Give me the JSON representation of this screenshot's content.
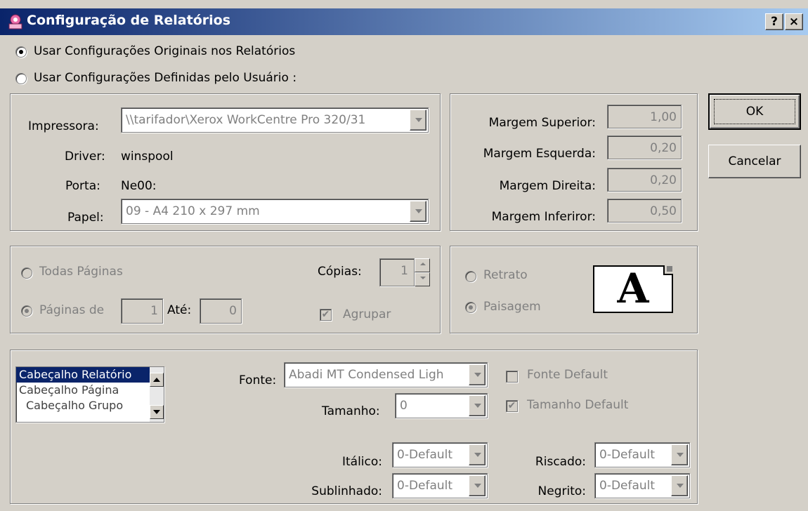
{
  "window": {
    "title": "Configuração de Relatórios",
    "help_button": "?",
    "close_button": "×"
  },
  "mode": {
    "original_label": "Usar Configurações Originais nos Relatórios",
    "user_label": "Usar Configurações Definidas pelo Usuário :",
    "selected": "original"
  },
  "printer": {
    "printer_label": "Impressora:",
    "printer_value": "\\\\tarifador\\Xerox WorkCentre Pro 320/31",
    "driver_label": "Driver:",
    "driver_value": "winspool",
    "port_label": "Porta:",
    "port_value": "Ne00:",
    "paper_label": "Papel:",
    "paper_value": "09  - A4 210 x 297 mm"
  },
  "margins": {
    "top_label": "Margem Superior:",
    "top_value": "1,00",
    "left_label": "Margem Esquerda:",
    "left_value": "0,20",
    "right_label": "Margem Direita:",
    "right_value": "0,20",
    "bottom_label": "Margem Inferiror:",
    "bottom_value": "0,50"
  },
  "buttons": {
    "ok": "OK",
    "cancel": "Cancelar"
  },
  "pages": {
    "all_label": "Todas Páginas",
    "range_label": "Páginas de",
    "from_value": "1",
    "to_label": "Até:",
    "to_value": "0",
    "copies_label": "Cópias:",
    "copies_value": "1",
    "collate_label": "Agrupar",
    "collate_checked": true,
    "selected": "range"
  },
  "orientation": {
    "portrait_label": "Retrato",
    "landscape_label": "Paisagem",
    "selected": "landscape",
    "preview_glyph": "A"
  },
  "sections": {
    "items": [
      "Cabeçalho Relatório",
      "Cabeçalho Página",
      "Cabeçalho Grupo"
    ],
    "selected_index": 0
  },
  "font": {
    "font_label": "Fonte:",
    "font_value": "Abadi MT Condensed Ligh",
    "font_default_label": "Fonte Default",
    "font_default_checked": false,
    "size_label": "Tamanho:",
    "size_value": "0",
    "size_default_label": "Tamanho Default",
    "size_default_checked": true,
    "italic_label": "Itálico:",
    "italic_value": "0-Default",
    "strike_label": "Riscado:",
    "strike_value": "0-Default",
    "underline_label": "Sublinhado:",
    "underline_value": "0-Default",
    "bold_label": "Negrito:",
    "bold_value": "0-Default"
  }
}
